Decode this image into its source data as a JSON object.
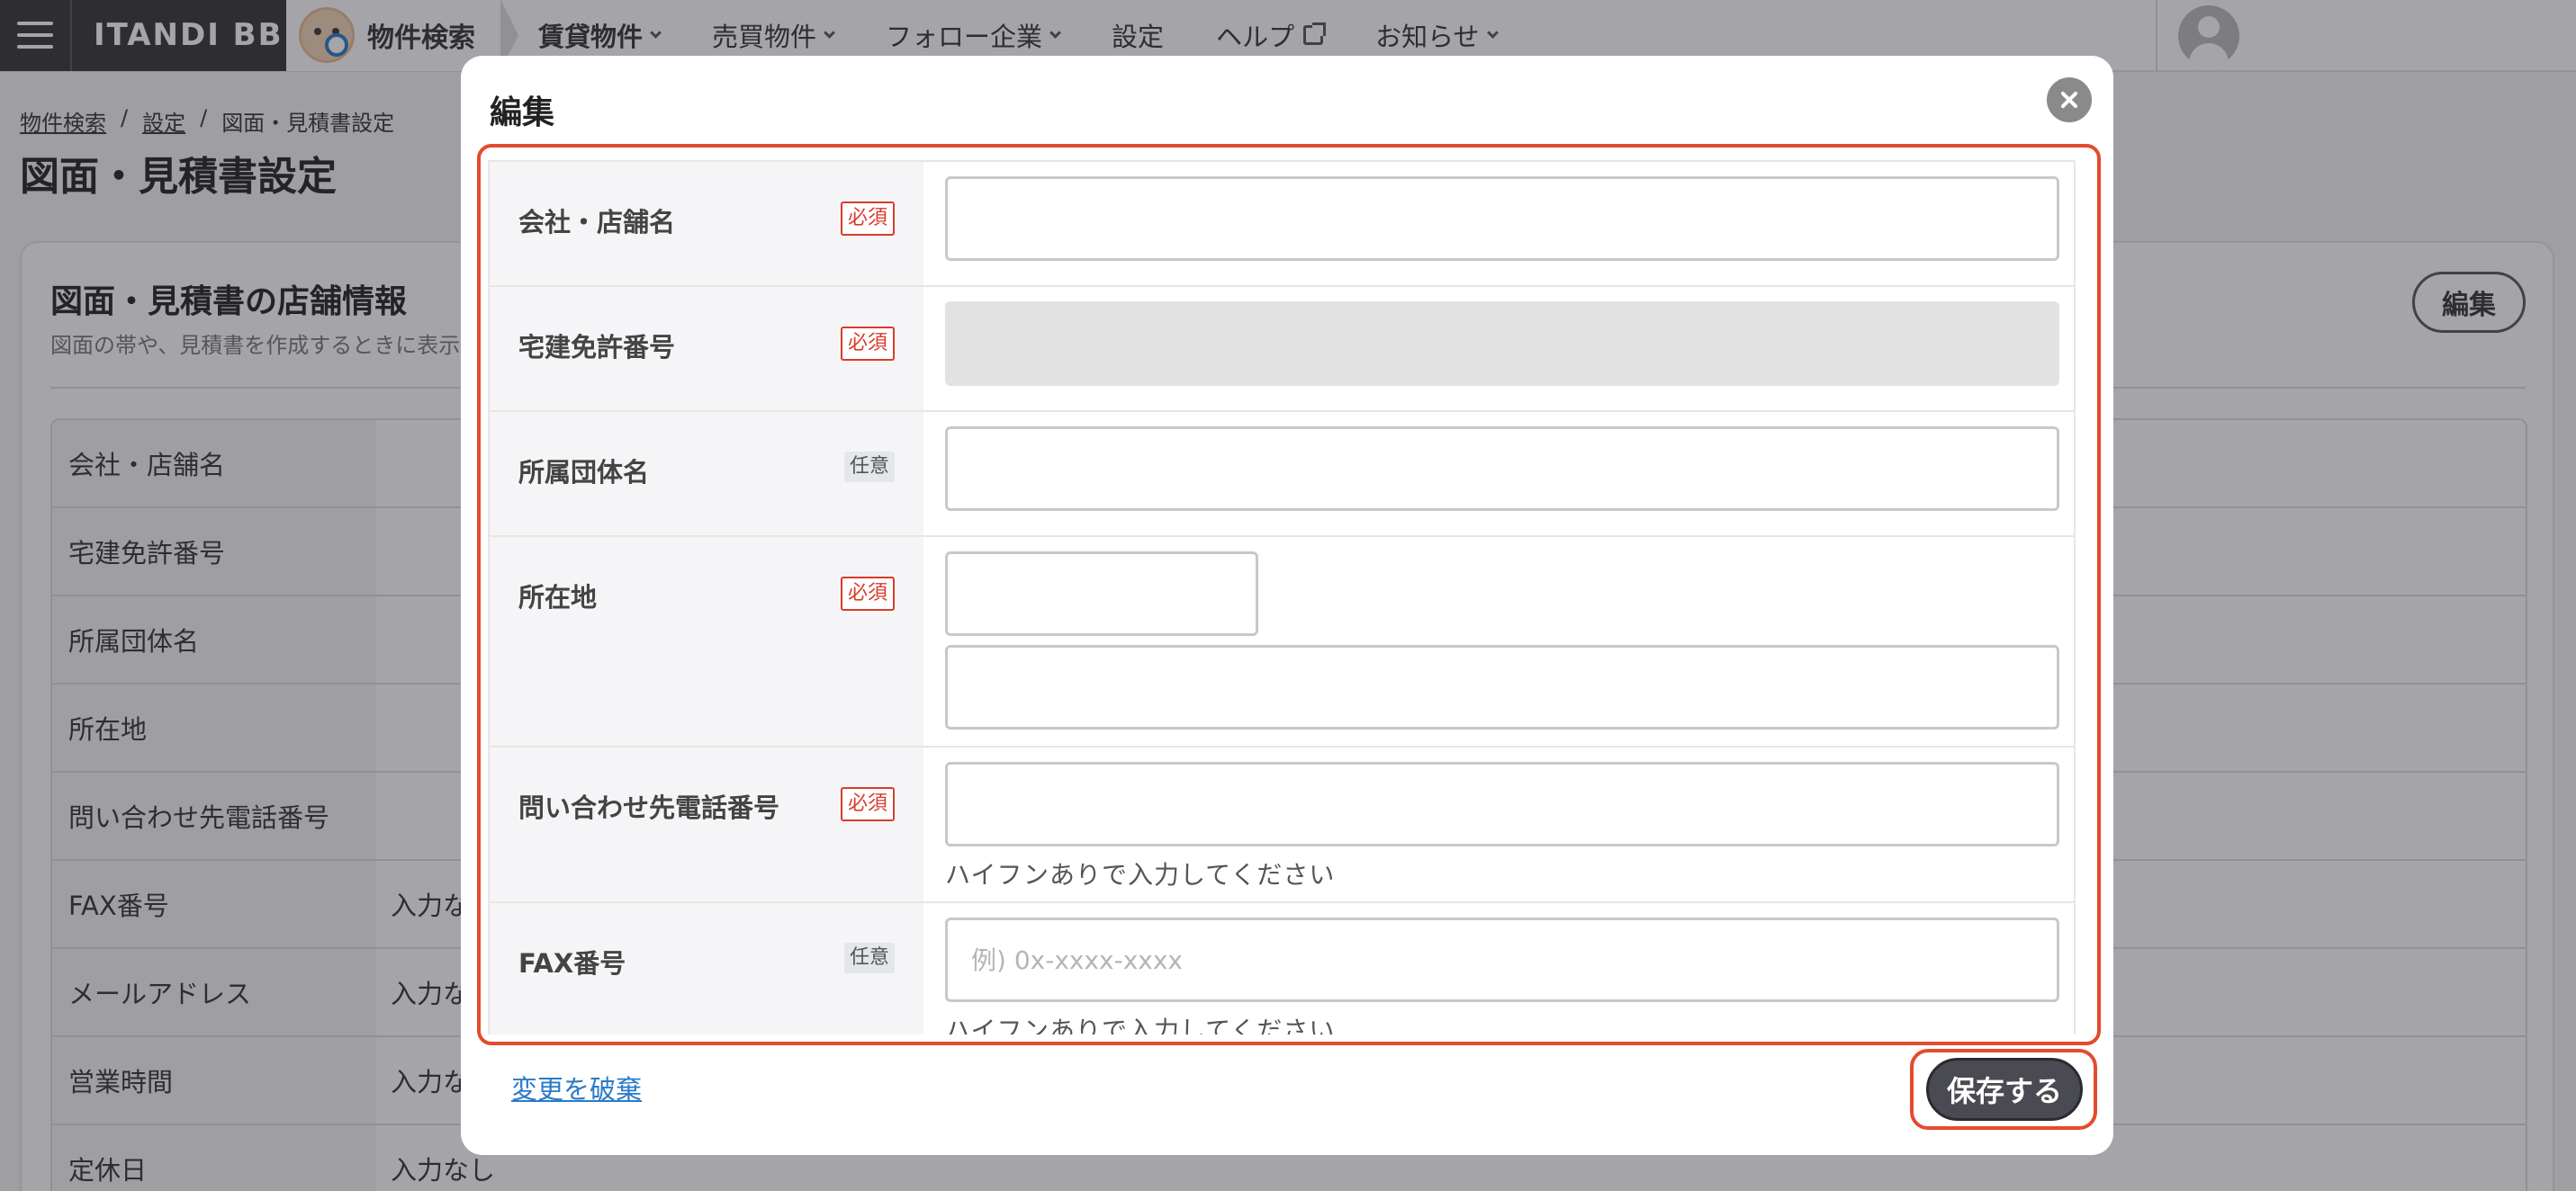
{
  "nav": {
    "brand": "ITANDI BB",
    "app": "物件検索",
    "items": [
      "賃貸物件",
      "売買物件",
      "フォロー企業",
      "設定",
      "ヘルプ",
      "お知らせ"
    ]
  },
  "breadcrumb": [
    "物件検索",
    "設定",
    "図面・見積書設定"
  ],
  "page_title": "図面・見積書設定",
  "card": {
    "title": "図面・見積書の店舗情報",
    "desc": "図面の帯や、見積書を作成するときに表示",
    "edit_label": "編集",
    "rows": [
      {
        "label": "会社・店舗名",
        "value": ""
      },
      {
        "label": "宅建免許番号",
        "value": ""
      },
      {
        "label": "所属団体名",
        "value": ""
      },
      {
        "label": "所在地",
        "value": ""
      },
      {
        "label": "問い合わせ先電話番号",
        "value": ""
      },
      {
        "label": "FAX番号",
        "value": "入力な"
      },
      {
        "label": "メールアドレス",
        "value": "入力な"
      },
      {
        "label": "営業時間",
        "value": "入力な"
      },
      {
        "label": "定休日",
        "value": "入力なし"
      }
    ]
  },
  "modal": {
    "title": "編集",
    "badge_required": "必須",
    "badge_optional": "任意",
    "fields": {
      "company": {
        "label": "会社・店舗名"
      },
      "license": {
        "label": "宅建免許番号"
      },
      "association": {
        "label": "所属団体名"
      },
      "address": {
        "label": "所在地"
      },
      "phone": {
        "label": "問い合わせ先電話番号",
        "hint": "ハイフンありで入力してください"
      },
      "fax": {
        "label": "FAX番号",
        "placeholder": "例) 0x-xxxx-xxxx",
        "hint": "ハイフンありで入力してください"
      }
    },
    "discard_label": "変更を破棄",
    "save_label": "保存する"
  }
}
